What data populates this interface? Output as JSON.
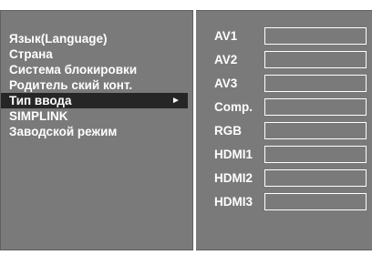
{
  "left_menu": {
    "items": [
      {
        "label": "Язык(Language)"
      },
      {
        "label": "Страна"
      },
      {
        "label": "Система блокировки"
      },
      {
        "label": "Родитель ский конт."
      },
      {
        "label": "Тип ввода",
        "selected": true,
        "arrow": "►"
      },
      {
        "label": "SIMPLINK"
      },
      {
        "label": "Заводской режим"
      }
    ]
  },
  "input_list": {
    "items": [
      {
        "label": "AV1",
        "value": ""
      },
      {
        "label": "AV2",
        "value": ""
      },
      {
        "label": "AV3",
        "value": ""
      },
      {
        "label": "Comp.",
        "value": ""
      },
      {
        "label": "RGB",
        "value": ""
      },
      {
        "label": "HDMI1",
        "value": ""
      },
      {
        "label": "HDMI2",
        "value": ""
      },
      {
        "label": "HDMI3",
        "value": ""
      }
    ]
  },
  "colors": {
    "panel_bg": "#7a7a7a",
    "selected_bg": "#262626",
    "text": "#ffffff",
    "page_bg": "#ffffff"
  }
}
